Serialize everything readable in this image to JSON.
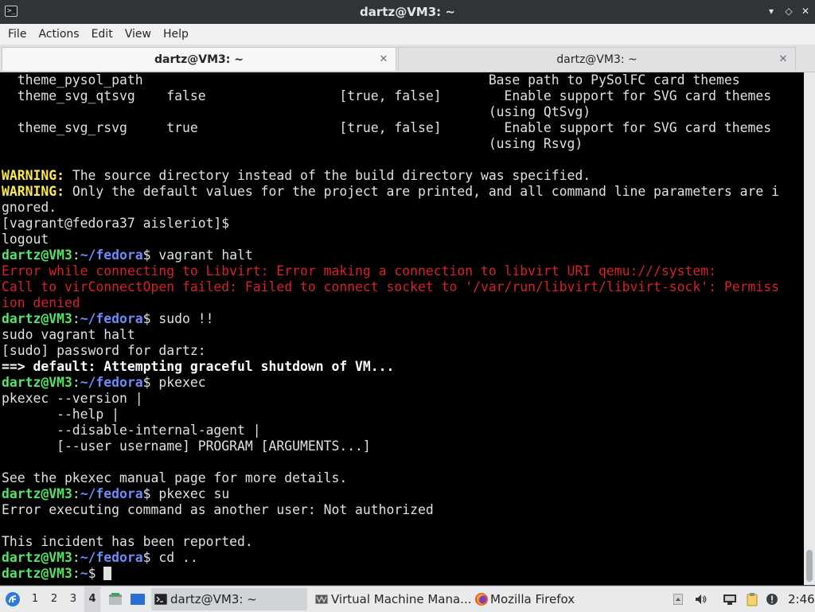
{
  "window": {
    "title": "dartz@VM3: ~",
    "minimize_glyph": "▾",
    "maximize_glyph": "◇",
    "close_glyph": "✕",
    "app_icon_glyph": ">_"
  },
  "menu": [
    "File",
    "Actions",
    "Edit",
    "View",
    "Help"
  ],
  "tabs": [
    {
      "label": "dartz@VM3: ~",
      "active": true,
      "close_glyph": "✕"
    },
    {
      "label": "dartz@VM3: ~",
      "active": false,
      "close_glyph": "✕"
    }
  ],
  "terminal": {
    "lines": [
      [
        {
          "t": "  theme_pysol_path                                            Base path to PySolFC card themes"
        }
      ],
      [
        {
          "t": "  theme_svg_qtsvg    false                 [true, false]        Enable support for SVG card themes"
        }
      ],
      [
        {
          "t": "                                                              (using QtSvg)"
        }
      ],
      [
        {
          "t": "  theme_svg_rsvg     true                  [true, false]        Enable support for SVG card themes"
        }
      ],
      [
        {
          "t": "                                                              (using Rsvg)"
        }
      ],
      [
        {
          "t": ""
        }
      ],
      [
        {
          "t": "WARNING:",
          "c": "c-yellow"
        },
        {
          "t": " The source directory instead of the build directory was specified."
        }
      ],
      [
        {
          "t": "WARNING:",
          "c": "c-yellow"
        },
        {
          "t": " Only the default values for the project are printed, and all command line parameters are i"
        }
      ],
      [
        {
          "t": "gnored."
        }
      ],
      [
        {
          "t": "[vagrant@fedora37 aisleriot]$"
        }
      ],
      [
        {
          "t": "logout"
        }
      ],
      [
        {
          "t": "dartz@VM3",
          "c": "c-green"
        },
        {
          "t": ":"
        },
        {
          "t": "~/fedora",
          "c": "c-blue"
        },
        {
          "t": "$ vagrant halt"
        }
      ],
      [
        {
          "t": "Error while connecting to Libvirt: Error making a connection to libvirt URI qemu:///system:",
          "c": "c-red"
        }
      ],
      [
        {
          "t": "Call to virConnectOpen failed: Failed to connect socket to '/var/run/libvirt/libvirt-sock': Permiss",
          "c": "c-red"
        }
      ],
      [
        {
          "t": "ion denied",
          "c": "c-red"
        }
      ],
      [
        {
          "t": "dartz@VM3",
          "c": "c-green"
        },
        {
          "t": ":"
        },
        {
          "t": "~/fedora",
          "c": "c-blue"
        },
        {
          "t": "$ sudo !!"
        }
      ],
      [
        {
          "t": "sudo vagrant halt"
        }
      ],
      [
        {
          "t": "[sudo] password for dartz:"
        }
      ],
      [
        {
          "t": "==> default: Attempting graceful shutdown of VM...",
          "c": "c-bold"
        }
      ],
      [
        {
          "t": "dartz@VM3",
          "c": "c-green"
        },
        {
          "t": ":"
        },
        {
          "t": "~/fedora",
          "c": "c-blue"
        },
        {
          "t": "$ pkexec"
        }
      ],
      [
        {
          "t": "pkexec --version |"
        }
      ],
      [
        {
          "t": "       --help |"
        }
      ],
      [
        {
          "t": "       --disable-internal-agent |"
        }
      ],
      [
        {
          "t": "       [--user username] PROGRAM [ARGUMENTS...]"
        }
      ],
      [
        {
          "t": ""
        }
      ],
      [
        {
          "t": "See the pkexec manual page for more details."
        }
      ],
      [
        {
          "t": "dartz@VM3",
          "c": "c-green"
        },
        {
          "t": ":"
        },
        {
          "t": "~/fedora",
          "c": "c-blue"
        },
        {
          "t": "$ pkexec su"
        }
      ],
      [
        {
          "t": "Error executing command as another user: Not authorized"
        }
      ],
      [
        {
          "t": ""
        }
      ],
      [
        {
          "t": "This incident has been reported."
        }
      ],
      [
        {
          "t": "dartz@VM3",
          "c": "c-green"
        },
        {
          "t": ":"
        },
        {
          "t": "~/fedora",
          "c": "c-blue"
        },
        {
          "t": "$ cd .."
        }
      ],
      [
        {
          "t": "dartz@VM3",
          "c": "c-green"
        },
        {
          "t": ":"
        },
        {
          "t": "~",
          "c": "c-blue"
        },
        {
          "t": "$ "
        }
      ]
    ]
  },
  "taskbar": {
    "workspaces": [
      {
        "label": "1",
        "active": false
      },
      {
        "label": "2",
        "active": false
      },
      {
        "label": "3",
        "active": false
      },
      {
        "label": "4",
        "active": true
      }
    ],
    "tasks": [
      {
        "label": "dartz@VM3: ~",
        "icon": "terminal-icon",
        "active": true
      },
      {
        "label": "Virtual Machine Mana...",
        "icon": "virt-manager-icon",
        "active": false
      },
      {
        "label": "Mozilla Firefox",
        "icon": "firefox-icon",
        "active": false
      }
    ],
    "clock": "2:46"
  },
  "colors": {
    "prompt_user": "#55e36a",
    "prompt_path": "#6e8cf5",
    "error": "#d6222a",
    "warning": "#fce94f"
  }
}
